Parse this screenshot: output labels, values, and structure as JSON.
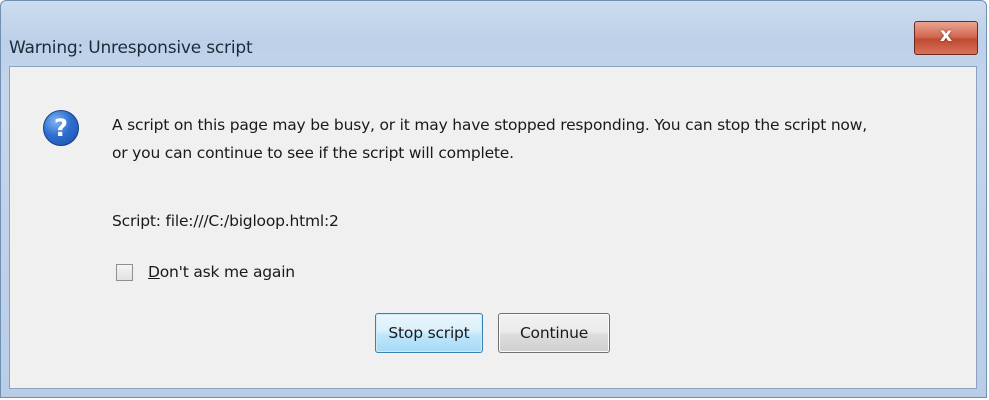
{
  "dialog": {
    "title": "Warning: Unresponsive script",
    "close_glyph": "x",
    "icon": "question-icon",
    "icon_glyph": "?",
    "message_line1": "A script on this page may be busy, or it may have stopped responding. You can stop the script now,",
    "message_line2": "or you can continue to see if the script will complete.",
    "script_label": "Script: file:///C:/bigloop.html:2",
    "checkbox": {
      "accesskey_char": "D",
      "label_rest": "on't ask me again",
      "checked": false
    },
    "buttons": {
      "stop_label": "Stop script",
      "continue_label": "Continue"
    }
  },
  "colors": {
    "frame": "#bcd0e8",
    "close_button": "#c14a33",
    "client_bg": "#f0f0f0",
    "default_button": "#bee6fd"
  }
}
